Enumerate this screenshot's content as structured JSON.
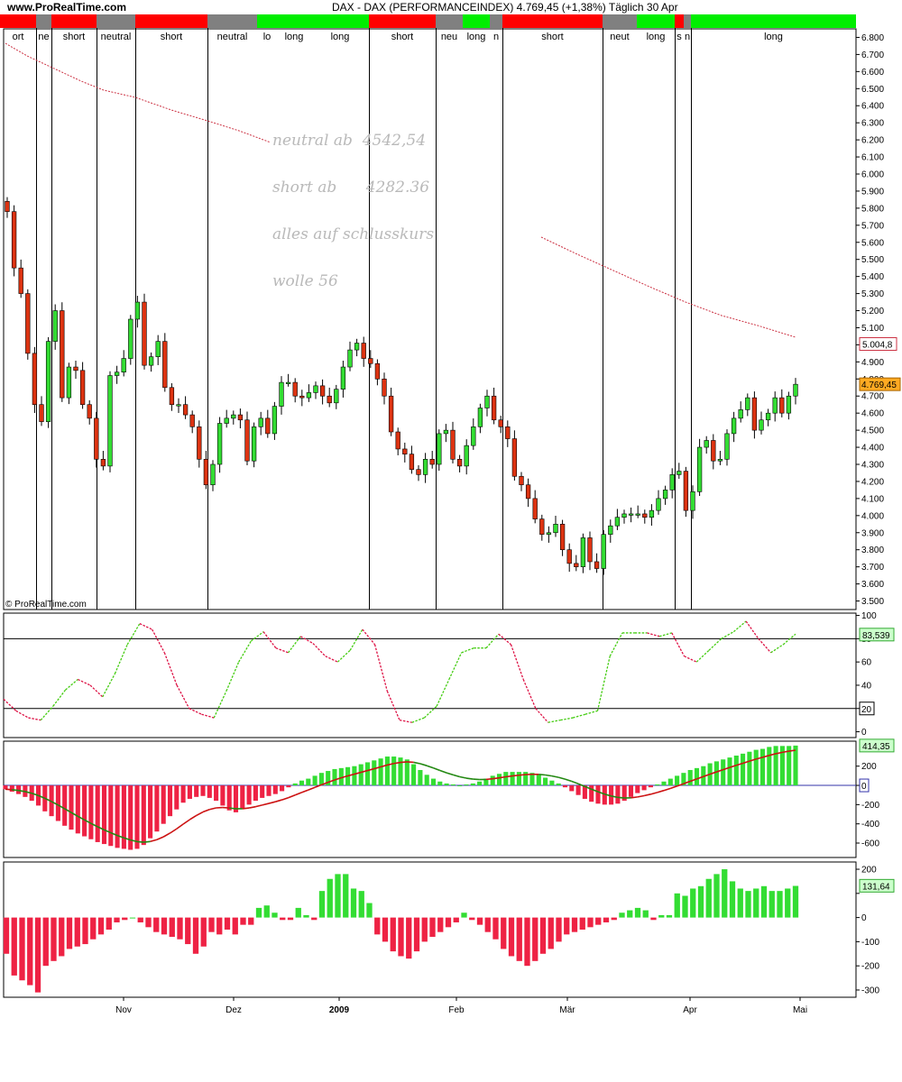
{
  "header": {
    "site": "www.ProRealTime.com",
    "title": "DAX - DAX (PERFORMANCEINDEX)    4.769,45 (+1,38%)    Täglich  30 Apr"
  },
  "copyright": "© ProRealTime.com",
  "annotations": [
    "neutral ab  4542,54",
    "short ab      4282.36",
    "alles auf schlusskurs",
    "wolle 56"
  ],
  "colors": {
    "up": "#33dd33",
    "down": "#dd3311",
    "signal_short": "#ff0000",
    "signal_long": "#00ee00",
    "signal_neutral": "#808080",
    "ma": "#cc3344"
  },
  "signal_band": [
    {
      "label": "ort",
      "state": "short"
    },
    {
      "label": "ne",
      "state": "neutral"
    },
    {
      "label": "short",
      "state": "short"
    },
    {
      "label": "neutral",
      "state": "neutral"
    },
    {
      "label": "short",
      "state": "short"
    },
    {
      "label": "neutral",
      "state": "neutral"
    },
    {
      "label": "lo",
      "state": "long"
    },
    {
      "label": "long",
      "state": "long"
    },
    {
      "label": "long",
      "state": "long"
    },
    {
      "label": "short",
      "state": "short"
    },
    {
      "label": "neu",
      "state": "neutral"
    },
    {
      "label": "long",
      "state": "long"
    },
    {
      "label": "n",
      "state": "neutral"
    },
    {
      "label": "short",
      "state": "short"
    },
    {
      "label": "neut",
      "state": "neutral"
    },
    {
      "label": "long",
      "state": "long"
    },
    {
      "label": "s",
      "state": "short"
    },
    {
      "label": "n",
      "state": "neutral"
    },
    {
      "label": "long",
      "state": "long"
    }
  ],
  "chart_data": [
    {
      "type": "candlestick",
      "title": "DAX - DAX (PERFORMANCEINDEX)",
      "period": "Täglich",
      "last_value": "4.769,45",
      "ma_value": "5.004,8",
      "x_months": [
        "Nov",
        "Dez",
        "2009",
        "Feb",
        "Mär",
        "Apr",
        "Mai"
      ],
      "ylim": [
        3450,
        6850
      ],
      "y_ticks": [
        "6.800",
        "6.700",
        "6.600",
        "6.500",
        "6.400",
        "6.300",
        "6.200",
        "6.100",
        "6.000",
        "5.900",
        "5.800",
        "5.700",
        "5.600",
        "5.500",
        "5.400",
        "5.300",
        "5.200",
        "5.100",
        "5.000",
        "4.900",
        "4.800",
        "4.700",
        "4.600",
        "4.500",
        "4.400",
        "4.300",
        "4.200",
        "4.100",
        "4.000",
        "3.900",
        "3.800",
        "3.700",
        "3.600",
        "3.500"
      ],
      "close": [
        5780,
        5450,
        5300,
        4950,
        4650,
        4550,
        5020,
        5200,
        4690,
        4870,
        4850,
        4650,
        4570,
        4330,
        4290,
        4820,
        4840,
        4920,
        5150,
        5250,
        4880,
        4930,
        5020,
        4750,
        4650,
        4650,
        4590,
        4520,
        4330,
        4180,
        4300,
        4540,
        4570,
        4590,
        4560,
        4320,
        4520,
        4570,
        4480,
        4640,
        4780,
        4780,
        4700,
        4690,
        4720,
        4760,
        4700,
        4660,
        4740,
        4870,
        4970,
        5010,
        4920,
        4890,
        4800,
        4700,
        4490,
        4390,
        4360,
        4270,
        4240,
        4330,
        4300,
        4480,
        4500,
        4330,
        4290,
        4410,
        4520,
        4630,
        4700,
        4560,
        4520,
        4450,
        4230,
        4180,
        4100,
        3980,
        3890,
        3900,
        3950,
        3800,
        3720,
        3700,
        3870,
        3730,
        3690,
        3890,
        3940,
        3990,
        4010,
        4010,
        4010,
        3990,
        4030,
        4100,
        4150,
        4240,
        4260,
        4030,
        4140,
        4400,
        4440,
        4320,
        4330,
        4480,
        4570,
        4620,
        4690,
        4500,
        4560,
        4600,
        4690,
        4600,
        4700,
        4769
      ]
    },
    {
      "type": "line",
      "name": "oscillator",
      "last_value": "83,539",
      "ylim": [
        -5,
        102
      ],
      "y_ticks": [
        0,
        20,
        40,
        60,
        80,
        100
      ],
      "reference_lines": [
        20,
        80
      ],
      "values": [
        28,
        18,
        12,
        10,
        22,
        36,
        45,
        40,
        30,
        50,
        75,
        93,
        88,
        68,
        40,
        20,
        15,
        12,
        35,
        60,
        78,
        86,
        72,
        68,
        82,
        76,
        65,
        60,
        70,
        88,
        75,
        35,
        10,
        8,
        12,
        22,
        45,
        68,
        72,
        72,
        84,
        75,
        45,
        20,
        8,
        10,
        12,
        15,
        18,
        65,
        85,
        85,
        85,
        82,
        85,
        65,
        60,
        70,
        80,
        86,
        95,
        80,
        68,
        75,
        84
      ]
    },
    {
      "type": "bar+line",
      "name": "histogram with signal line",
      "last_value": "414,35",
      "ylim": [
        -750,
        460
      ],
      "y_ticks": [
        200,
        0,
        -200,
        -400,
        -600
      ],
      "values": [
        -40,
        -65,
        -90,
        -120,
        -160,
        -210,
        -270,
        -320,
        -370,
        -420,
        -460,
        -500,
        -530,
        -560,
        -590,
        -610,
        -630,
        -650,
        -660,
        -670,
        -660,
        -620,
        -550,
        -480,
        -400,
        -320,
        -250,
        -180,
        -140,
        -120,
        -110,
        -130,
        -160,
        -210,
        -260,
        -280,
        -240,
        -200,
        -160,
        -130,
        -110,
        -90,
        -60,
        -20,
        20,
        50,
        70,
        100,
        130,
        150,
        170,
        180,
        190,
        200,
        220,
        240,
        260,
        280,
        300,
        300,
        290,
        270,
        220,
        160,
        110,
        70,
        40,
        20,
        10,
        0,
        10,
        20,
        40,
        70,
        100,
        120,
        140,
        140,
        140,
        140,
        130,
        110,
        80,
        50,
        20,
        -20,
        -60,
        -100,
        -140,
        -170,
        -190,
        -200,
        -200,
        -190,
        -160,
        -120,
        -80,
        -50,
        -20,
        10,
        40,
        70,
        100,
        130,
        160,
        180,
        200,
        230,
        250,
        270,
        290,
        310,
        330,
        350,
        370,
        380,
        400,
        410,
        410,
        410,
        414
      ]
    },
    {
      "type": "bar",
      "name": "momentum histogram",
      "last_value": "131,64",
      "ylim": [
        -330,
        230
      ],
      "y_ticks": [
        200,
        100,
        0,
        -100,
        -200,
        -300
      ],
      "values": [
        -150,
        -240,
        -260,
        -280,
        -310,
        -200,
        -180,
        -160,
        -130,
        -120,
        -110,
        -90,
        -70,
        -50,
        -20,
        -10,
        0,
        -20,
        -40,
        -60,
        -70,
        -80,
        -90,
        -110,
        -150,
        -120,
        -60,
        -70,
        -50,
        -70,
        -30,
        -30,
        40,
        50,
        20,
        -10,
        -10,
        40,
        10,
        -10,
        110,
        160,
        180,
        180,
        120,
        110,
        60,
        -70,
        -100,
        -140,
        -160,
        -170,
        -140,
        -100,
        -80,
        -60,
        -40,
        -20,
        20,
        -10,
        -30,
        -60,
        -90,
        -130,
        -160,
        -180,
        -200,
        -180,
        -150,
        -130,
        -100,
        -70,
        -60,
        -50,
        -40,
        -30,
        -20,
        -10,
        20,
        30,
        40,
        30,
        -10,
        10,
        10,
        100,
        90,
        120,
        130,
        160,
        180,
        200,
        150,
        120,
        110,
        120,
        130,
        110,
        110,
        120,
        131
      ]
    }
  ]
}
